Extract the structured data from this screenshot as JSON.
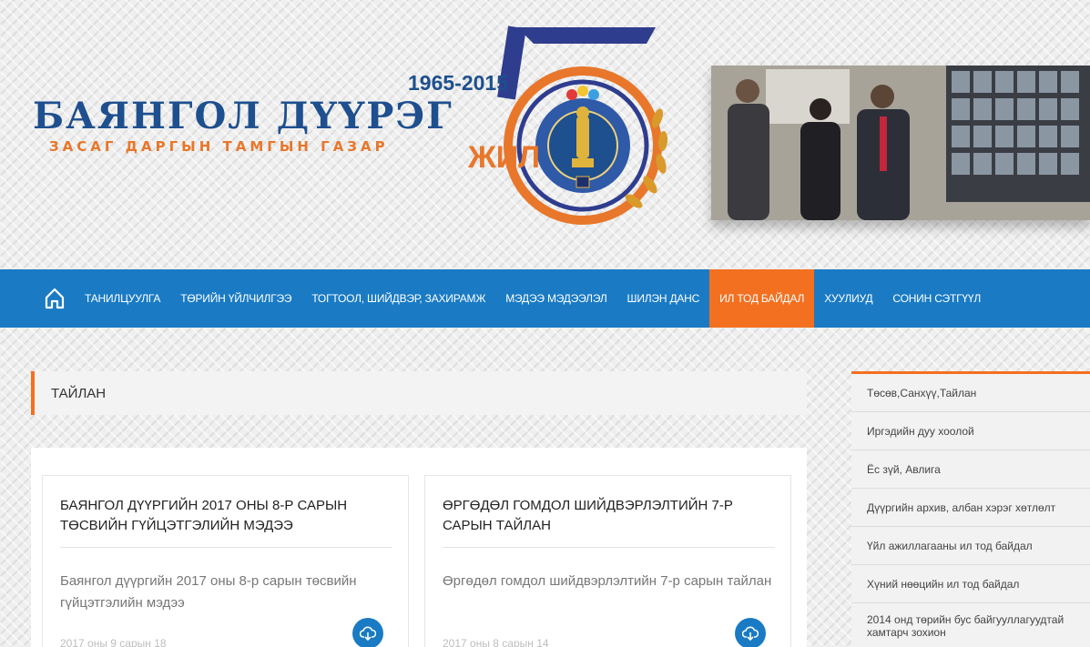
{
  "header": {
    "brand_title": "БАЯНГОЛ ДҮҮРЭГ",
    "brand_subtitle": "ЗАСАГ ДАРГЫН ТАМГЫН ГАЗАР",
    "anniversary_years": "1965-2015",
    "anniversary_number": "5",
    "anniversary_word": "ЖИЛ",
    "emblem_text": "БАЯНГОЛ ДҮҮРЭГ"
  },
  "nav": {
    "home_icon": "home-icon",
    "items": [
      {
        "label": "ТАНИЛЦУУЛГА"
      },
      {
        "label": "ТӨРИЙН ҮЙЛЧИЛГЭЭ"
      },
      {
        "label": "ТОГТООЛ, ШИЙДВЭР, ЗАХИРАМЖ"
      },
      {
        "label": "МЭДЭЭ МЭДЭЭЛЭЛ"
      },
      {
        "label": "ШИЛЭН ДАНС"
      },
      {
        "label": "ИЛ ТОД БАЙДАЛ"
      },
      {
        "label": "ХУУЛИУД"
      },
      {
        "label": "СОНИН СЭТГҮҮЛ"
      }
    ],
    "active_index": 5
  },
  "section": {
    "title": "ТАЙЛАН"
  },
  "cards": [
    {
      "title": "БАЯНГОЛ ДҮҮРГИЙН 2017 ОНЫ 8-Р САРЫН ТӨСВИЙН ГҮЙЦЭТГЭЛИЙН МЭДЭЭ",
      "excerpt": "Баянгол дүүргийн 2017 оны 8-р сарын төсвийн гүйцэтгэлийн мэдээ",
      "date": "2017 оны 9 сарын 18",
      "icon": "cloud-download-icon"
    },
    {
      "title": "ӨРГӨДӨЛ ГОМДОЛ ШИЙДВЭРЛЭЛТИЙН 7-Р САРЫН ТАЙЛАН",
      "excerpt": "Өргөдөл гомдол шийдвэрлэлтийн 7-р сарын тайлан",
      "date": "2017 оны 8 сарын 14",
      "icon": "cloud-download-icon"
    }
  ],
  "sidebar": {
    "items": [
      {
        "label": "Төсөв,Санхүү,Тайлан"
      },
      {
        "label": "Иргэдийн дуу хоолой"
      },
      {
        "label": "Ёс зүй, Авлига"
      },
      {
        "label": "Дүүргийн архив, албан хэрэг хөтлөлт"
      },
      {
        "label": "Үйл ажиллагааны ил тод байдал"
      },
      {
        "label": "Хүний нөөцийн ил тод байдал"
      },
      {
        "label": "2014 онд төрийн бус байгууллагуудтай хамтарч зохион"
      }
    ]
  },
  "colors": {
    "nav_blue": "#1a7bc4",
    "accent_orange": "#f37021",
    "brand_blue": "#1e4f8e"
  }
}
